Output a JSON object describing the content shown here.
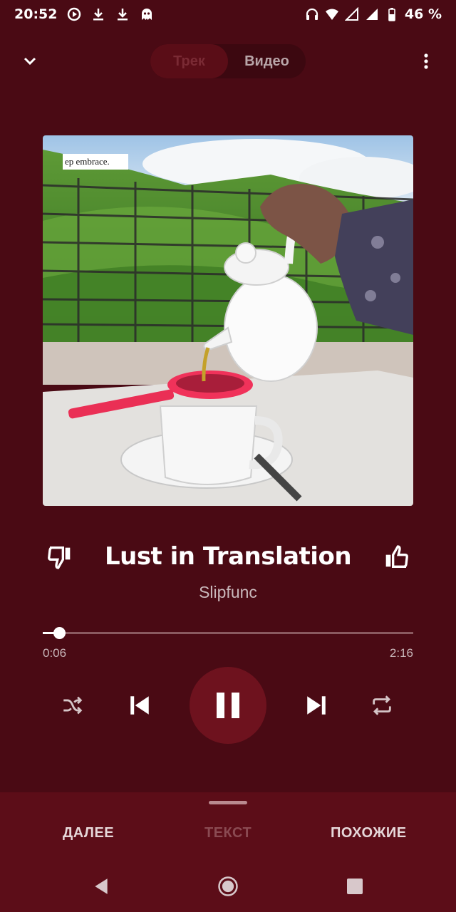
{
  "status_bar": {
    "time": "20:52",
    "battery": "46 %",
    "left_icons": [
      "media-icon",
      "download-icon",
      "download-icon",
      "ghost-icon"
    ],
    "right_icons": [
      "headphones-icon",
      "wifi-icon",
      "signal-icon",
      "signal-icon",
      "battery-icon"
    ]
  },
  "header": {
    "tabs": [
      {
        "label": "Трек",
        "active": true
      },
      {
        "label": "Видео",
        "active": false
      }
    ]
  },
  "album_art": {
    "caption": "ep embrace."
  },
  "track": {
    "title": "Lust in Translation",
    "artist": "Slipfunc"
  },
  "progress": {
    "current": "0:06",
    "total": "2:16",
    "fraction": 0.044
  },
  "bottom_sheet": {
    "tabs": [
      {
        "label": "ДАЛЕЕ",
        "active": false
      },
      {
        "label": "ТЕКСТ",
        "active": false,
        "disabled": true
      },
      {
        "label": "ПОХОЖИЕ",
        "active": false
      }
    ]
  },
  "colors": {
    "background": "#4a0a14",
    "play_button": "#6e121e",
    "sheet": "#5c0d18"
  }
}
